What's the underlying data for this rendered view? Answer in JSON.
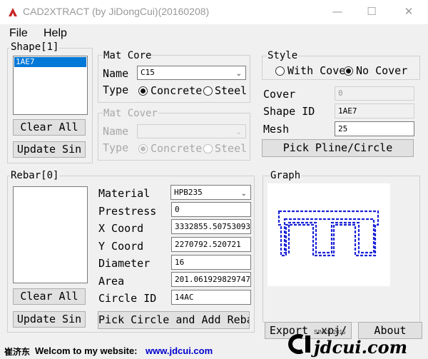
{
  "window": {
    "title": "CAD2XTRACT (by JiDongCui)(20160208)",
    "minimize_glyph": "—",
    "maximize_glyph": "☐",
    "close_glyph": "✕"
  },
  "menu": {
    "file": "File",
    "help": "Help"
  },
  "shape": {
    "legend": "Shape[1]",
    "items": [
      "1AE7"
    ],
    "clear_all": "Clear All",
    "update_sin": "Update Sin"
  },
  "mat_core": {
    "legend": "Mat Core",
    "name_label": "Name",
    "name_value": "C15",
    "type_label": "Type",
    "concrete": "Concrete",
    "steel": "Steel"
  },
  "mat_cover": {
    "legend": "Mat Cover",
    "name_label": "Name",
    "name_value": "",
    "type_label": "Type",
    "concrete": "Concrete",
    "steel": "Steel"
  },
  "style": {
    "legend": "Style",
    "with_cover": "With Cove",
    "no_cover": "No Cover",
    "cover_label": "Cover",
    "cover_value": "0",
    "shape_id_label": "Shape ID",
    "shape_id_value": "1AE7",
    "mesh_label": "Mesh",
    "mesh_value": "25",
    "pick_button": "Pick Pline/Circle"
  },
  "rebar": {
    "legend": "Rebar[0]",
    "clear_all": "Clear All",
    "update_sin": "Update Sin",
    "material_label": "Material",
    "material_value": "HPB235",
    "prestress_label": "Prestress",
    "prestress_value": "0",
    "xcoord_label": "X Coord",
    "xcoord_value": "3332855.50753093",
    "ycoord_label": "Y Coord",
    "ycoord_value": "2270792.520721",
    "diameter_label": "Diameter",
    "diameter_value": "16",
    "area_label": "Area",
    "area_value": "201.061929829747",
    "circle_id_label": "Circle ID",
    "circle_id_value": "14AC",
    "pick_button": "Pick Circle and Add Reba"
  },
  "graph": {
    "legend": "Graph",
    "export_button": "Export .xpj/",
    "about_button": "About"
  },
  "status": {
    "author": "崔济东",
    "welcome": "Welcom to my website:",
    "url": "www.jdcui.com"
  },
  "logo": {
    "text": "jdcui.com",
    "since": "SINCE 2015"
  },
  "colors": {
    "selection": "#0078d7",
    "graph_line": "#1a22d6",
    "url": "#0000cc"
  }
}
